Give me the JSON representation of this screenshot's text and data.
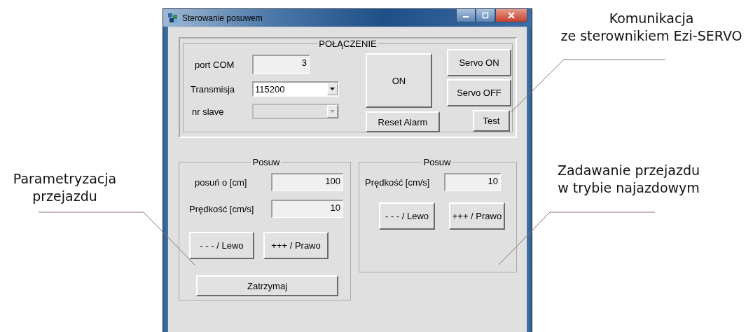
{
  "window": {
    "title": "Sterowanie posuwem"
  },
  "connection": {
    "title": "POŁĄCZENIE",
    "port_label": "port COM",
    "port_value": "3",
    "transmission_label": "Transmisja",
    "transmission_value": "115200",
    "slave_label": "nr slave",
    "slave_disabled": true,
    "buttons": [
      {
        "kind": "big",
        "label": "ON"
      },
      {
        "kind": "wide",
        "label": "Reset Alarm"
      },
      {
        "kind": "side",
        "label": "Servo ON"
      },
      {
        "kind": "side",
        "label": "Servo OFF"
      },
      {
        "kind": "small",
        "label": "Test"
      }
    ]
  },
  "feed_panels": [
    {
      "title": "Posuw",
      "fields": [
        {
          "label": "posuń o [cm]",
          "value": "100"
        },
        {
          "label": "Prędkość [cm/s]",
          "value": "10"
        }
      ],
      "buttons": [
        "- - - / Lewo",
        "+++ / Prawo"
      ],
      "stop_button": "Zatrzymaj"
    },
    {
      "title": "Posuw",
      "fields": [
        {
          "label": "Prędkość [cm/s]",
          "value": "10"
        }
      ],
      "buttons": [
        "- - - / Lewo",
        "+++ / Prawo"
      ]
    }
  ],
  "annotations": [
    {
      "text": "Komunikacja\nze sterownikiem Ezi-SERVO"
    },
    {
      "text": "Parametryzacja\nprzejazdu"
    },
    {
      "text": "Zadawanie przejazdu\nw trybie najazdowym"
    }
  ]
}
